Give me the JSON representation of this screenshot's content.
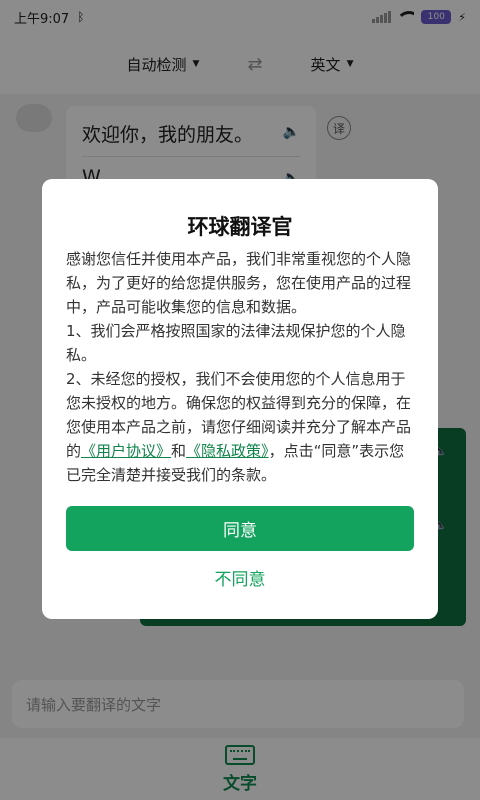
{
  "status_bar": {
    "time": "上午9:07",
    "battery": "100"
  },
  "lang_bar": {
    "source": "自动检测",
    "target": "英文"
  },
  "chat": {
    "source_text": "欢迎你，我的朋友。",
    "translation_text": "W...",
    "translate_badge": "译"
  },
  "input": {
    "placeholder": "请输入要翻译的文字"
  },
  "bottom_nav": {
    "label": "文字"
  },
  "dialog": {
    "title": "环球翻译官",
    "intro": "感谢您信任并使用本产品，我们非常重视您的个人隐私，为了更好的给您提供服务，您在使用产品的过程中，产品可能收集您的信息和数据。",
    "item1": "1、我们会严格按照国家的法律法规保护您的个人隐私。",
    "item2_a": "2、未经您的授权，我们不会使用您的个人信息用于您未授权的地方。确保您的权益得到充分的保障，在您使用本产品之前，请您仔细阅读并充分了解本产品的",
    "link_user_agreement": "《用户协议》",
    "and": "和",
    "link_privacy": "《隐私政策》",
    "item2_b": "，点击“同意”表示您已完全清楚并接受我们的条款。",
    "agree_label": "同意",
    "disagree_label": "不同意"
  },
  "colors": {
    "accent": "#14a35e",
    "card": "#0f6f43"
  }
}
